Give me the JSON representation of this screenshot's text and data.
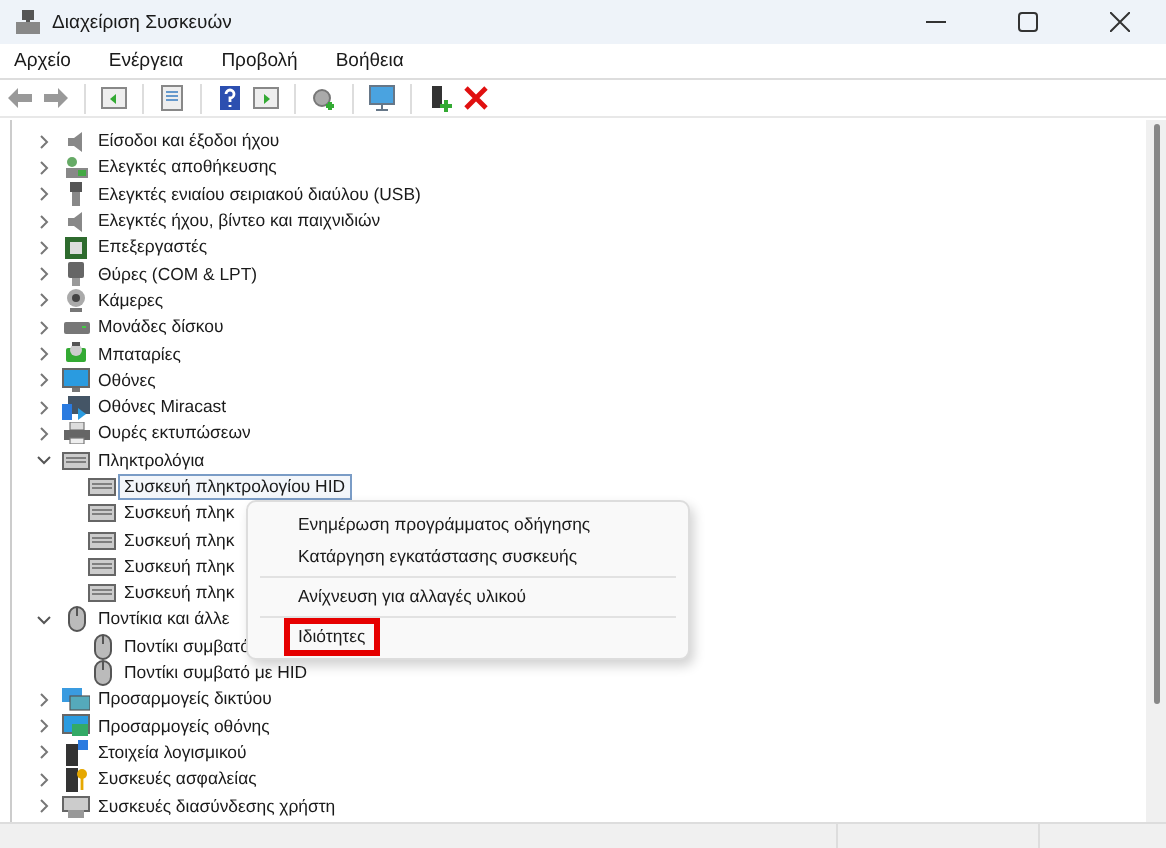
{
  "window": {
    "title": "Διαχείριση Συσκευών"
  },
  "menu_bar": [
    "Αρχείο",
    "Ενέργεια",
    "Προβολή",
    "Βοήθεια"
  ],
  "tree": [
    {
      "label": "Είσοδοι και έξοδοι ήχου",
      "expanded": false,
      "selected": false
    },
    {
      "label": "Ελεγκτές αποθήκευσης",
      "expanded": false,
      "selected": false
    },
    {
      "label": "Ελεγκτές ενιαίου σειριακού διαύλου (USB)",
      "expanded": false,
      "selected": false
    },
    {
      "label": "Ελεγκτές ήχου, βίντεο και παιχνιδιών",
      "expanded": false,
      "selected": false
    },
    {
      "label": "Επεξεργαστές",
      "expanded": false,
      "selected": false
    },
    {
      "label": "Θύρες (COM & LPT)",
      "expanded": false,
      "selected": false
    },
    {
      "label": "Κάμερες",
      "expanded": false,
      "selected": false
    },
    {
      "label": "Μονάδες δίσκου",
      "expanded": false,
      "selected": false
    },
    {
      "label": "Μπαταρίες",
      "expanded": false,
      "selected": false
    },
    {
      "label": "Οθόνες",
      "expanded": false,
      "selected": false
    },
    {
      "label": "Οθόνες Miracast",
      "expanded": false,
      "selected": false
    },
    {
      "label": "Ουρές εκτυπώσεων",
      "expanded": false,
      "selected": false
    },
    {
      "label": "Πληκτρολόγια",
      "expanded": true,
      "selected": false,
      "children": [
        {
          "label": "Συσκευή πληκτρολογίου HID",
          "selected": true
        },
        {
          "label": "Συσκευή πληκ",
          "selected": false
        },
        {
          "label": "Συσκευή πληκ",
          "selected": false
        },
        {
          "label": "Συσκευή πληκ",
          "selected": false
        },
        {
          "label": "Συσκευή πληκ",
          "selected": false
        }
      ]
    },
    {
      "label": "Ποντίκια και άλλε",
      "expanded": true,
      "selected": false,
      "children": [
        {
          "label": "Ποντίκι συμβατό",
          "selected": false
        },
        {
          "label": "Ποντίκι συμβατό με HID",
          "selected": false
        }
      ]
    },
    {
      "label": "Προσαρμογείς δικτύου",
      "expanded": false,
      "selected": false
    },
    {
      "label": "Προσαρμογείς οθόνης",
      "expanded": false,
      "selected": false
    },
    {
      "label": "Στοιχεία λογισμικού",
      "expanded": false,
      "selected": false
    },
    {
      "label": "Συσκευές ασφαλείας",
      "expanded": false,
      "selected": false
    },
    {
      "label": "Συσκευές διασύνδεσης χρήστη",
      "expanded": false,
      "selected": false
    }
  ],
  "context_menu": [
    {
      "label": "Ενημέρωση προγράμματος οδήγησης",
      "highlighted": false,
      "separator_after": false
    },
    {
      "label": "Κατάργηση εγκατάστασης συσκευής",
      "highlighted": false,
      "separator_after": true
    },
    {
      "label": "Ανίχνευση για αλλαγές υλικού",
      "highlighted": false,
      "separator_after": true
    },
    {
      "label": "Ιδιότητες",
      "highlighted": true,
      "separator_after": false
    }
  ]
}
